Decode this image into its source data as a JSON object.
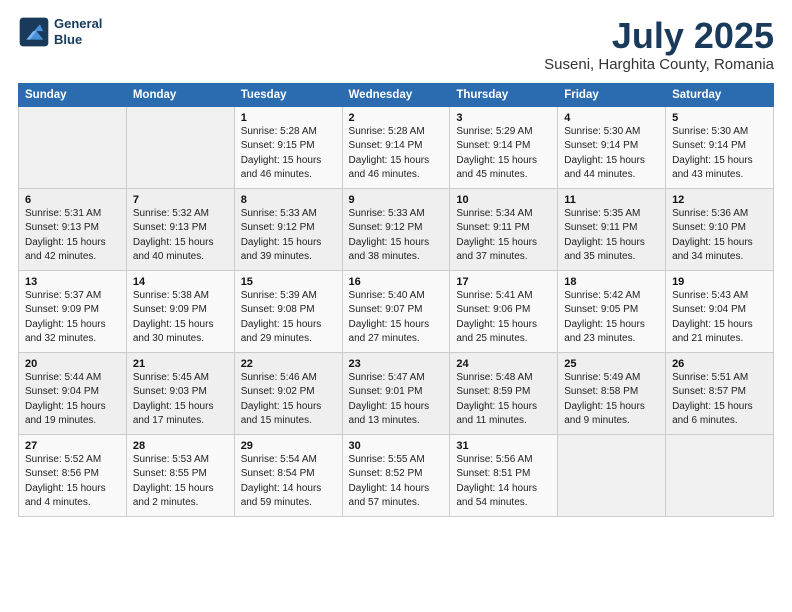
{
  "logo": {
    "line1": "General",
    "line2": "Blue"
  },
  "title": "July 2025",
  "subtitle": "Suseni, Harghita County, Romania",
  "weekdays": [
    "Sunday",
    "Monday",
    "Tuesday",
    "Wednesday",
    "Thursday",
    "Friday",
    "Saturday"
  ],
  "weeks": [
    [
      {
        "day": "",
        "info": ""
      },
      {
        "day": "",
        "info": ""
      },
      {
        "day": "1",
        "info": "Sunrise: 5:28 AM\nSunset: 9:15 PM\nDaylight: 15 hours\nand 46 minutes."
      },
      {
        "day": "2",
        "info": "Sunrise: 5:28 AM\nSunset: 9:14 PM\nDaylight: 15 hours\nand 46 minutes."
      },
      {
        "day": "3",
        "info": "Sunrise: 5:29 AM\nSunset: 9:14 PM\nDaylight: 15 hours\nand 45 minutes."
      },
      {
        "day": "4",
        "info": "Sunrise: 5:30 AM\nSunset: 9:14 PM\nDaylight: 15 hours\nand 44 minutes."
      },
      {
        "day": "5",
        "info": "Sunrise: 5:30 AM\nSunset: 9:14 PM\nDaylight: 15 hours\nand 43 minutes."
      }
    ],
    [
      {
        "day": "6",
        "info": "Sunrise: 5:31 AM\nSunset: 9:13 PM\nDaylight: 15 hours\nand 42 minutes."
      },
      {
        "day": "7",
        "info": "Sunrise: 5:32 AM\nSunset: 9:13 PM\nDaylight: 15 hours\nand 40 minutes."
      },
      {
        "day": "8",
        "info": "Sunrise: 5:33 AM\nSunset: 9:12 PM\nDaylight: 15 hours\nand 39 minutes."
      },
      {
        "day": "9",
        "info": "Sunrise: 5:33 AM\nSunset: 9:12 PM\nDaylight: 15 hours\nand 38 minutes."
      },
      {
        "day": "10",
        "info": "Sunrise: 5:34 AM\nSunset: 9:11 PM\nDaylight: 15 hours\nand 37 minutes."
      },
      {
        "day": "11",
        "info": "Sunrise: 5:35 AM\nSunset: 9:11 PM\nDaylight: 15 hours\nand 35 minutes."
      },
      {
        "day": "12",
        "info": "Sunrise: 5:36 AM\nSunset: 9:10 PM\nDaylight: 15 hours\nand 34 minutes."
      }
    ],
    [
      {
        "day": "13",
        "info": "Sunrise: 5:37 AM\nSunset: 9:09 PM\nDaylight: 15 hours\nand 32 minutes."
      },
      {
        "day": "14",
        "info": "Sunrise: 5:38 AM\nSunset: 9:09 PM\nDaylight: 15 hours\nand 30 minutes."
      },
      {
        "day": "15",
        "info": "Sunrise: 5:39 AM\nSunset: 9:08 PM\nDaylight: 15 hours\nand 29 minutes."
      },
      {
        "day": "16",
        "info": "Sunrise: 5:40 AM\nSunset: 9:07 PM\nDaylight: 15 hours\nand 27 minutes."
      },
      {
        "day": "17",
        "info": "Sunrise: 5:41 AM\nSunset: 9:06 PM\nDaylight: 15 hours\nand 25 minutes."
      },
      {
        "day": "18",
        "info": "Sunrise: 5:42 AM\nSunset: 9:05 PM\nDaylight: 15 hours\nand 23 minutes."
      },
      {
        "day": "19",
        "info": "Sunrise: 5:43 AM\nSunset: 9:04 PM\nDaylight: 15 hours\nand 21 minutes."
      }
    ],
    [
      {
        "day": "20",
        "info": "Sunrise: 5:44 AM\nSunset: 9:04 PM\nDaylight: 15 hours\nand 19 minutes."
      },
      {
        "day": "21",
        "info": "Sunrise: 5:45 AM\nSunset: 9:03 PM\nDaylight: 15 hours\nand 17 minutes."
      },
      {
        "day": "22",
        "info": "Sunrise: 5:46 AM\nSunset: 9:02 PM\nDaylight: 15 hours\nand 15 minutes."
      },
      {
        "day": "23",
        "info": "Sunrise: 5:47 AM\nSunset: 9:01 PM\nDaylight: 15 hours\nand 13 minutes."
      },
      {
        "day": "24",
        "info": "Sunrise: 5:48 AM\nSunset: 8:59 PM\nDaylight: 15 hours\nand 11 minutes."
      },
      {
        "day": "25",
        "info": "Sunrise: 5:49 AM\nSunset: 8:58 PM\nDaylight: 15 hours\nand 9 minutes."
      },
      {
        "day": "26",
        "info": "Sunrise: 5:51 AM\nSunset: 8:57 PM\nDaylight: 15 hours\nand 6 minutes."
      }
    ],
    [
      {
        "day": "27",
        "info": "Sunrise: 5:52 AM\nSunset: 8:56 PM\nDaylight: 15 hours\nand 4 minutes."
      },
      {
        "day": "28",
        "info": "Sunrise: 5:53 AM\nSunset: 8:55 PM\nDaylight: 15 hours\nand 2 minutes."
      },
      {
        "day": "29",
        "info": "Sunrise: 5:54 AM\nSunset: 8:54 PM\nDaylight: 14 hours\nand 59 minutes."
      },
      {
        "day": "30",
        "info": "Sunrise: 5:55 AM\nSunset: 8:52 PM\nDaylight: 14 hours\nand 57 minutes."
      },
      {
        "day": "31",
        "info": "Sunrise: 5:56 AM\nSunset: 8:51 PM\nDaylight: 14 hours\nand 54 minutes."
      },
      {
        "day": "",
        "info": ""
      },
      {
        "day": "",
        "info": ""
      }
    ]
  ]
}
